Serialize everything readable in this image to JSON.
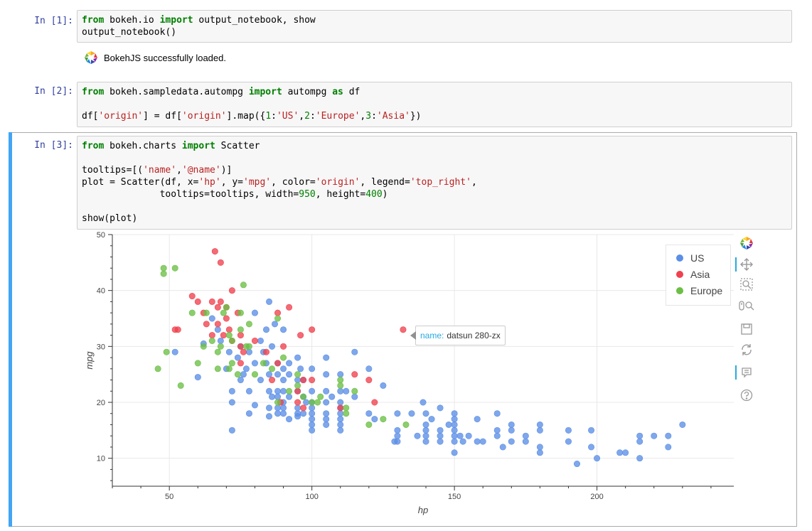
{
  "cells": [
    {
      "prompt": "In [1]:",
      "lines": [
        [
          {
            "t": "from",
            "c": "kw"
          },
          {
            "t": " bokeh.io "
          },
          {
            "t": "import",
            "c": "kw"
          },
          {
            "t": " output_notebook, show"
          }
        ],
        [
          {
            "t": "output_notebook()"
          }
        ]
      ]
    },
    {
      "prompt": "In [2]:",
      "lines": [
        [
          {
            "t": "from",
            "c": "kw"
          },
          {
            "t": " bokeh.sampledata.autompg "
          },
          {
            "t": "import",
            "c": "kw"
          },
          {
            "t": " autompg "
          },
          {
            "t": "as",
            "c": "kw"
          },
          {
            "t": " df"
          }
        ],
        [
          {
            "t": ""
          }
        ],
        [
          {
            "t": "df["
          },
          {
            "t": "'origin'",
            "c": "str"
          },
          {
            "t": "] = df["
          },
          {
            "t": "'origin'",
            "c": "str"
          },
          {
            "t": "].map({"
          },
          {
            "t": "1",
            "c": "num"
          },
          {
            "t": ":"
          },
          {
            "t": "'US'",
            "c": "str"
          },
          {
            "t": ","
          },
          {
            "t": "2",
            "c": "num"
          },
          {
            "t": ":"
          },
          {
            "t": "'Europe'",
            "c": "str"
          },
          {
            "t": ","
          },
          {
            "t": "3",
            "c": "num"
          },
          {
            "t": ":"
          },
          {
            "t": "'Asia'",
            "c": "str"
          },
          {
            "t": "})"
          }
        ]
      ]
    },
    {
      "prompt": "In [3]:",
      "lines": [
        [
          {
            "t": "from",
            "c": "kw"
          },
          {
            "t": " bokeh.charts "
          },
          {
            "t": "import",
            "c": "kw"
          },
          {
            "t": " Scatter"
          }
        ],
        [
          {
            "t": ""
          }
        ],
        [
          {
            "t": "tooltips=[("
          },
          {
            "t": "'name'",
            "c": "str"
          },
          {
            "t": ","
          },
          {
            "t": "'@name'",
            "c": "str"
          },
          {
            "t": ")]"
          }
        ],
        [
          {
            "t": "plot = Scatter(df, x="
          },
          {
            "t": "'hp'",
            "c": "str"
          },
          {
            "t": ", y="
          },
          {
            "t": "'mpg'",
            "c": "str"
          },
          {
            "t": ", color="
          },
          {
            "t": "'origin'",
            "c": "str"
          },
          {
            "t": ", legend="
          },
          {
            "t": "'top_right'",
            "c": "str"
          },
          {
            "t": ","
          }
        ],
        [
          {
            "t": "              tooltips=tooltips, width="
          },
          {
            "t": "950",
            "c": "num"
          },
          {
            "t": ", height="
          },
          {
            "t": "400",
            "c": "num"
          },
          {
            "t": ")"
          }
        ],
        [
          {
            "t": ""
          }
        ],
        [
          {
            "t": "show(plot)"
          }
        ]
      ]
    }
  ],
  "output_message": "BokehJS successfully loaded.",
  "tooltip": {
    "key": "name:",
    "value": "datsun 280-zx"
  },
  "toolbar_icons": [
    "bokeh-logo-icon",
    "pan-icon",
    "box-zoom-icon",
    "wheel-zoom-icon",
    "save-icon",
    "reset-icon",
    "hover-icon",
    "help-icon"
  ],
  "colors": {
    "US": "#5b8ee6",
    "Asia": "#f0414e",
    "Europe": "#6bbf45"
  },
  "chart_data": {
    "type": "scatter",
    "xlabel": "hp",
    "ylabel": "mpg",
    "xlim": [
      30,
      248
    ],
    "ylim": [
      5,
      50
    ],
    "xticks": [
      50,
      100,
      150,
      200
    ],
    "yticks": [
      10,
      20,
      30,
      40,
      50
    ],
    "grid": true,
    "legend_position": "top_right",
    "series": [
      {
        "name": "US",
        "color": "#5b8ee6",
        "points": [
          [
            52,
            29
          ],
          [
            60,
            24.5
          ],
          [
            62,
            30.5
          ],
          [
            65,
            35
          ],
          [
            67,
            33
          ],
          [
            68,
            31
          ],
          [
            70,
            26
          ],
          [
            71,
            29
          ],
          [
            72,
            20
          ],
          [
            72,
            22
          ],
          [
            72,
            15
          ],
          [
            74,
            28
          ],
          [
            75,
            30
          ],
          [
            75,
            24
          ],
          [
            76,
            25
          ],
          [
            77,
            26
          ],
          [
            78,
            29
          ],
          [
            78,
            22
          ],
          [
            78,
            18
          ],
          [
            80,
            36
          ],
          [
            80,
            27
          ],
          [
            80,
            19.5
          ],
          [
            82,
            31
          ],
          [
            82,
            24
          ],
          [
            83,
            29
          ],
          [
            84,
            33
          ],
          [
            84,
            27
          ],
          [
            85,
            38
          ],
          [
            85,
            25
          ],
          [
            85,
            22
          ],
          [
            85,
            19
          ],
          [
            85,
            17.5
          ],
          [
            86,
            30
          ],
          [
            86,
            21
          ],
          [
            87,
            34
          ],
          [
            88,
            27
          ],
          [
            88,
            25
          ],
          [
            88,
            22
          ],
          [
            88,
            21
          ],
          [
            88,
            19
          ],
          [
            88,
            18
          ],
          [
            90,
            33
          ],
          [
            90,
            26
          ],
          [
            90,
            24
          ],
          [
            90,
            22
          ],
          [
            90,
            20
          ],
          [
            90,
            19
          ],
          [
            90,
            18
          ],
          [
            92,
            27
          ],
          [
            92,
            25
          ],
          [
            92,
            21
          ],
          [
            92,
            17
          ],
          [
            95,
            28
          ],
          [
            95,
            24
          ],
          [
            95,
            22
          ],
          [
            95,
            19
          ],
          [
            95,
            18
          ],
          [
            95,
            17.5
          ],
          [
            96,
            26
          ],
          [
            97,
            24
          ],
          [
            97,
            21
          ],
          [
            97,
            18
          ],
          [
            98,
            20
          ],
          [
            100,
            26
          ],
          [
            100,
            22
          ],
          [
            100,
            20
          ],
          [
            100,
            19
          ],
          [
            100,
            18
          ],
          [
            100,
            17
          ],
          [
            100,
            16
          ],
          [
            100,
            15
          ],
          [
            105,
            28
          ],
          [
            105,
            25
          ],
          [
            105,
            22
          ],
          [
            105,
            20
          ],
          [
            105,
            18
          ],
          [
            105,
            17
          ],
          [
            105,
            16
          ],
          [
            107,
            21
          ],
          [
            110,
            25
          ],
          [
            110,
            22
          ],
          [
            110,
            20
          ],
          [
            110,
            19
          ],
          [
            110,
            18
          ],
          [
            110,
            17
          ],
          [
            110,
            16
          ],
          [
            110,
            15
          ],
          [
            112,
            22
          ],
          [
            115,
            29
          ],
          [
            115,
            21
          ],
          [
            120,
            26
          ],
          [
            120,
            18
          ],
          [
            122,
            17
          ],
          [
            125,
            23
          ],
          [
            129,
            13
          ],
          [
            130,
            18
          ],
          [
            130,
            15
          ],
          [
            130,
            14
          ],
          [
            130,
            13
          ],
          [
            135,
            18
          ],
          [
            137,
            14
          ],
          [
            139,
            20
          ],
          [
            140,
            18
          ],
          [
            140,
            16
          ],
          [
            140,
            15
          ],
          [
            140,
            14
          ],
          [
            140,
            13
          ],
          [
            142,
            17
          ],
          [
            145,
            19
          ],
          [
            145,
            15
          ],
          [
            145,
            14
          ],
          [
            145,
            13
          ],
          [
            148,
            16
          ],
          [
            150,
            18
          ],
          [
            150,
            17
          ],
          [
            150,
            16
          ],
          [
            150,
            15
          ],
          [
            150,
            14
          ],
          [
            150,
            13
          ],
          [
            150,
            11
          ],
          [
            152,
            14
          ],
          [
            153,
            13
          ],
          [
            155,
            14
          ],
          [
            158,
            17
          ],
          [
            158,
            13
          ],
          [
            160,
            13
          ],
          [
            165,
            18
          ],
          [
            165,
            15
          ],
          [
            165,
            14
          ],
          [
            167,
            12
          ],
          [
            170,
            16
          ],
          [
            170,
            15
          ],
          [
            170,
            13
          ],
          [
            175,
            14
          ],
          [
            175,
            13
          ],
          [
            180,
            16
          ],
          [
            180,
            15
          ],
          [
            180,
            12
          ],
          [
            180,
            11
          ],
          [
            190,
            15
          ],
          [
            190,
            13
          ],
          [
            193,
            9
          ],
          [
            198,
            15
          ],
          [
            198,
            12
          ],
          [
            200,
            10
          ],
          [
            208,
            11
          ],
          [
            210,
            11
          ],
          [
            215,
            14
          ],
          [
            215,
            13
          ],
          [
            215,
            10
          ],
          [
            220,
            14
          ],
          [
            225,
            14
          ],
          [
            225,
            12
          ],
          [
            230,
            16
          ]
        ]
      },
      {
        "name": "Asia",
        "color": "#f0414e",
        "points": [
          [
            52,
            33
          ],
          [
            53,
            33
          ],
          [
            58,
            39
          ],
          [
            60,
            38
          ],
          [
            62,
            36
          ],
          [
            63,
            34
          ],
          [
            65,
            38
          ],
          [
            65,
            32
          ],
          [
            66,
            47
          ],
          [
            67,
            37
          ],
          [
            67,
            34
          ],
          [
            68,
            45
          ],
          [
            68,
            38
          ],
          [
            69,
            32
          ],
          [
            70,
            37
          ],
          [
            70,
            35
          ],
          [
            71,
            33
          ],
          [
            72,
            31
          ],
          [
            72,
            40
          ],
          [
            74,
            36
          ],
          [
            75,
            32
          ],
          [
            75,
            30
          ],
          [
            75,
            27
          ],
          [
            76,
            29
          ],
          [
            80,
            31
          ],
          [
            84,
            29
          ],
          [
            86,
            24
          ],
          [
            88,
            27
          ],
          [
            88,
            36
          ],
          [
            89,
            20
          ],
          [
            90,
            30
          ],
          [
            92,
            37
          ],
          [
            95,
            22
          ],
          [
            95,
            20
          ],
          [
            96,
            32
          ],
          [
            97,
            19
          ],
          [
            97,
            24
          ],
          [
            100,
            33
          ],
          [
            100,
            24
          ],
          [
            110,
            19
          ],
          [
            115,
            25
          ],
          [
            120,
            24
          ],
          [
            122,
            20
          ],
          [
            132,
            33
          ]
        ]
      },
      {
        "name": "Europe",
        "color": "#6bbf45",
        "points": [
          [
            46,
            26
          ],
          [
            48,
            44
          ],
          [
            48,
            43
          ],
          [
            49,
            29
          ],
          [
            52,
            44
          ],
          [
            54,
            23
          ],
          [
            58,
            36
          ],
          [
            60,
            27
          ],
          [
            62,
            30
          ],
          [
            63,
            36
          ],
          [
            65,
            31
          ],
          [
            67,
            29
          ],
          [
            67,
            26
          ],
          [
            68,
            30
          ],
          [
            69,
            36
          ],
          [
            70,
            37
          ],
          [
            71,
            26
          ],
          [
            71,
            32
          ],
          [
            72,
            27
          ],
          [
            72,
            31
          ],
          [
            74,
            25
          ],
          [
            75,
            36
          ],
          [
            75,
            33
          ],
          [
            76,
            41
          ],
          [
            77,
            30
          ],
          [
            78,
            30
          ],
          [
            78,
            34
          ],
          [
            80,
            25
          ],
          [
            83,
            27
          ],
          [
            86,
            26
          ],
          [
            88,
            35
          ],
          [
            88,
            20
          ],
          [
            90,
            28
          ],
          [
            92,
            22
          ],
          [
            95,
            25
          ],
          [
            95,
            23
          ],
          [
            97,
            21
          ],
          [
            100,
            20
          ],
          [
            102,
            20
          ],
          [
            103,
            21
          ],
          [
            110,
            24
          ],
          [
            110,
            23
          ],
          [
            112,
            18
          ],
          [
            112,
            19
          ],
          [
            115,
            22
          ],
          [
            120,
            16
          ],
          [
            125,
            17
          ],
          [
            133,
            16
          ]
        ]
      }
    ]
  }
}
